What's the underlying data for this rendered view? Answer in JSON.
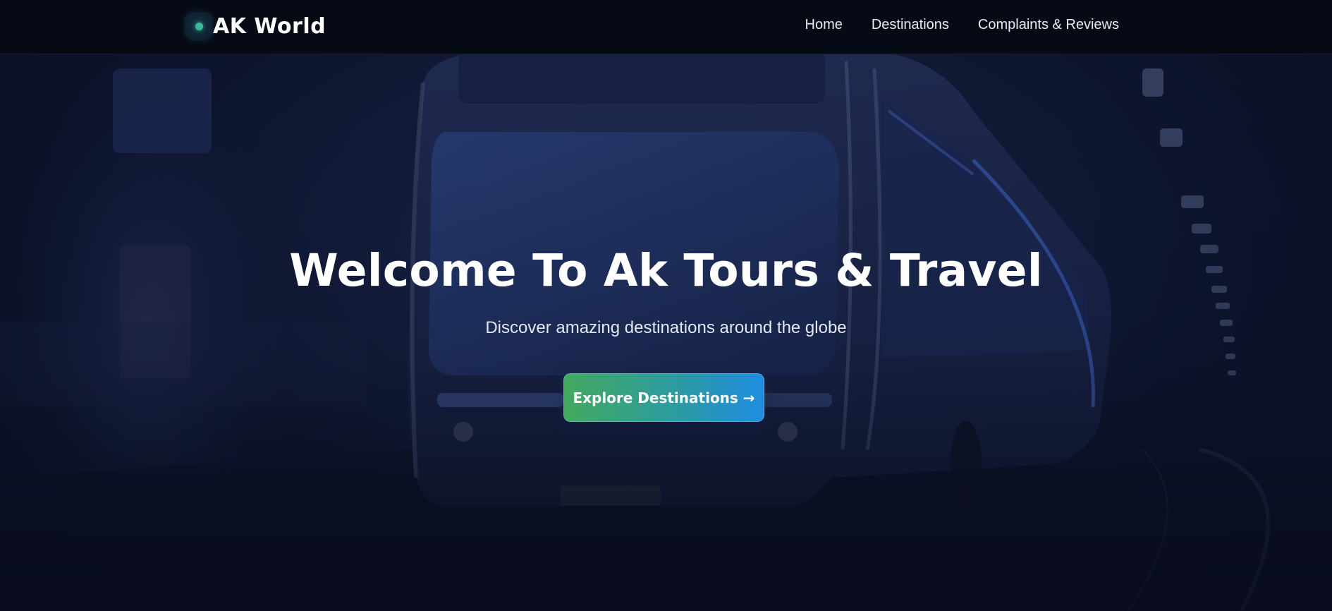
{
  "navbar": {
    "brand_name": "AK World",
    "links": [
      {
        "label": "Home"
      },
      {
        "label": "Destinations"
      },
      {
        "label": "Complaints & Reviews"
      }
    ]
  },
  "hero": {
    "title": "Welcome To Ak Tours & Travel",
    "subtitle": "Discover amazing destinations around the globe",
    "cta_label": "Explore Destinations →",
    "background_image": "bus-at-night-photo"
  },
  "colors": {
    "navbar_bg": "#060a14",
    "brand_dot": "#3ab79c",
    "cta_gradient_start": "#43a95f",
    "cta_gradient_end": "#1f8de0",
    "hero_bg": "#141d3d"
  }
}
